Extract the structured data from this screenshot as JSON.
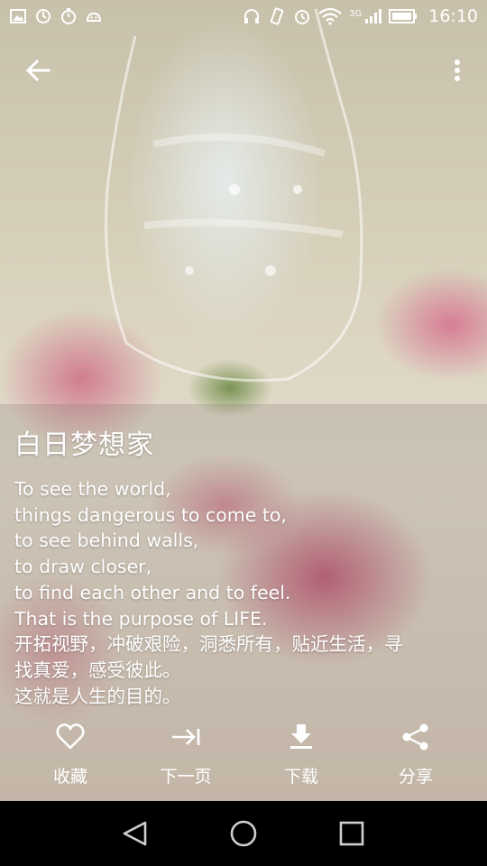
{
  "status_bar": {
    "time": "16:10",
    "network": "3G",
    "left_icons": [
      "gallery-icon",
      "clock-sync-icon",
      "timer-icon",
      "android-icon"
    ],
    "right_icons": [
      "headphones-icon",
      "vibrate-icon",
      "alarm-icon",
      "wifi-icon",
      "signal-icon",
      "battery-icon"
    ]
  },
  "toolbar": {
    "back_icon": "arrow-left-icon",
    "more_icon": "more-vert-icon"
  },
  "quote": {
    "title": "白日梦想家",
    "lines": [
      "To see the world,",
      "things dangerous to come to,",
      "to see behind walls,",
      "to draw closer,",
      "to find each other and to feel.",
      "That is the purpose of LIFE.",
      "开拓视野，冲破艰险，洞悉所有，贴近生活，寻",
      "找真爱，感受彼此。",
      "这就是人生的目的。"
    ]
  },
  "actions": [
    {
      "label": "收藏",
      "icon": "heart-outline-icon"
    },
    {
      "label": "下一页",
      "icon": "next-page-icon"
    },
    {
      "label": "下载",
      "icon": "download-icon"
    },
    {
      "label": "分享",
      "icon": "share-icon"
    }
  ],
  "nav": {
    "icons": [
      "back-triangle-icon",
      "home-circle-icon",
      "recents-square-icon"
    ]
  },
  "colors": {
    "text": "#ffffff",
    "nav_bg": "#000000",
    "rose": "#c9607e"
  }
}
